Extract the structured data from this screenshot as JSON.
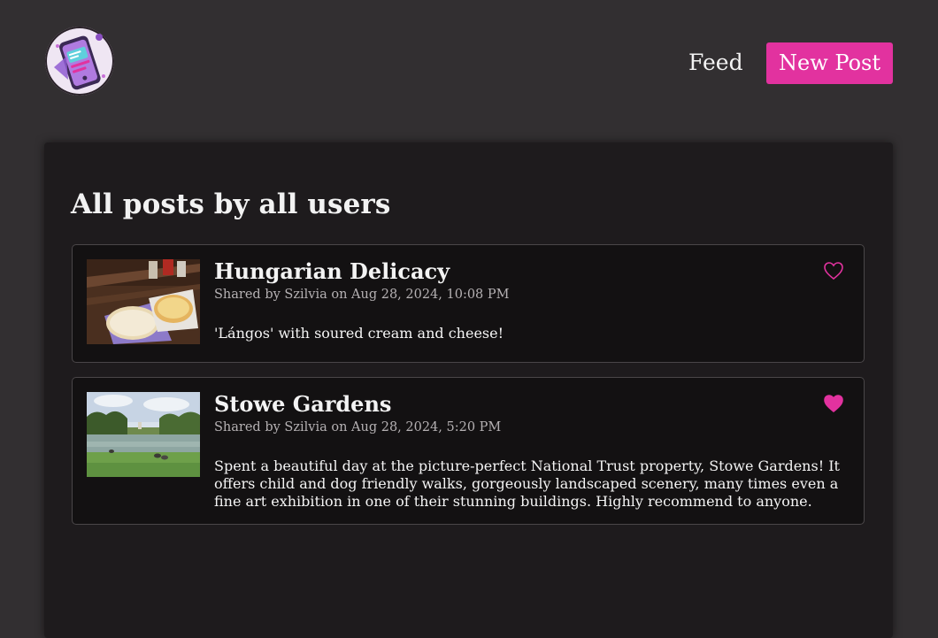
{
  "nav": {
    "feed_label": "Feed",
    "new_post_label": "New Post"
  },
  "main": {
    "title": "All posts by all users"
  },
  "posts": [
    {
      "title": "Hungarian Delicacy",
      "meta": "Shared by Szilvia on Aug 28, 2024, 10:08 PM",
      "body": "'Lángos' with soured cream and cheese!",
      "liked": false,
      "image": "food-photo"
    },
    {
      "title": "Stowe Gardens",
      "meta": "Shared by Szilvia on Aug 28, 2024, 5:20 PM",
      "body": "Spent a beautiful day at the picture-perfect National Trust property, Stowe Gardens! It offers child and dog friendly walks, gorgeously landscaped scenery, many times even a fine art exhibition in one of their stunning buildings. Highly recommend to anyone.",
      "liked": true,
      "image": "garden-lake-photo"
    }
  ],
  "colors": {
    "accent": "#e2329f",
    "background": "#322f31",
    "panel": "#1e1b1d",
    "card": "#131112"
  }
}
